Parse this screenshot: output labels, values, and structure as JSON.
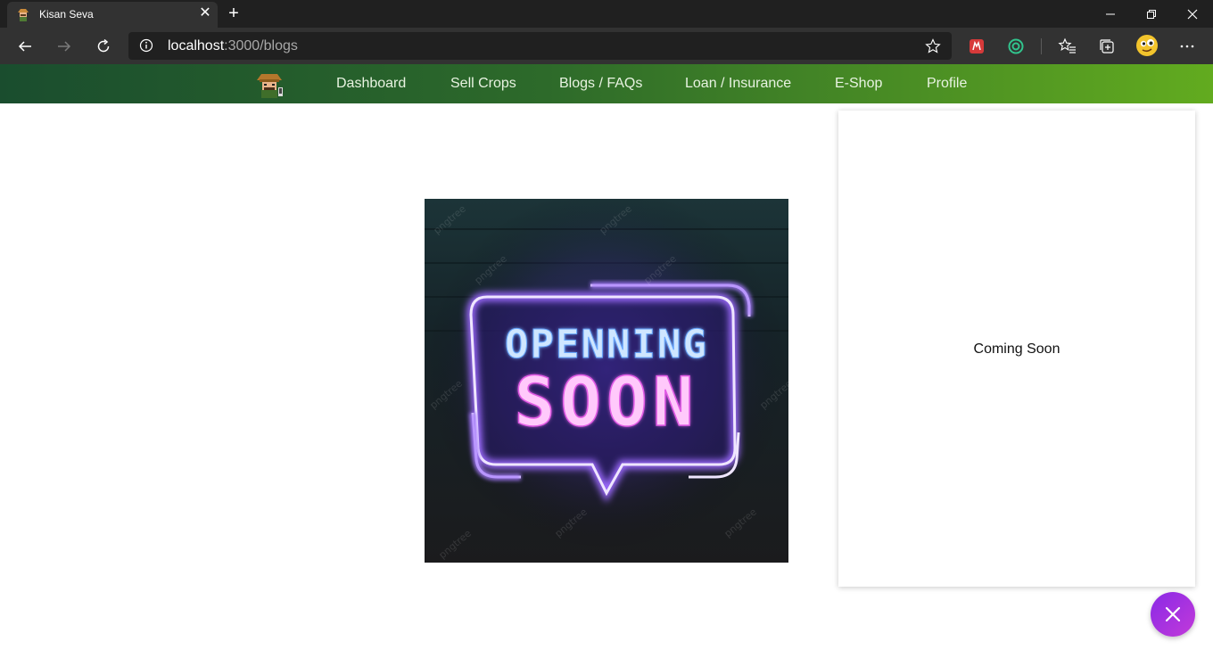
{
  "browser": {
    "tab": {
      "title": "Kisan Seva"
    },
    "address": {
      "host": "localhost",
      "path": ":3000/blogs"
    },
    "icons": [
      "back-icon",
      "forward-icon",
      "refresh-icon",
      "info-icon",
      "favorite-star-icon",
      "extension-icon",
      "extension-icon",
      "favorites-icon",
      "collections-icon",
      "profile-avatar",
      "more-icon"
    ]
  },
  "nav": {
    "logo": "farmer-logo",
    "links": [
      "Dashboard",
      "Sell Crops",
      "Blogs / FAQs",
      "Loan / Insurance",
      "E-Shop",
      "Profile"
    ]
  },
  "main": {
    "hero_line1": "OPENNING",
    "hero_line2": "SOON",
    "watermark": "pngtree",
    "side_text": "Coming Soon"
  },
  "colors": {
    "nav_start": "#1a4d2e",
    "nav_end": "#62ab1f",
    "fab": "#a033e0",
    "neon_blue": "#7db9ff",
    "neon_pink": "#f06cf0"
  }
}
